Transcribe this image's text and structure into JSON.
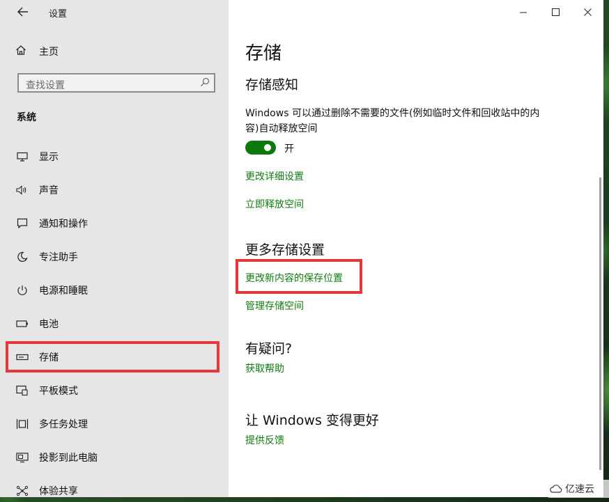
{
  "app": {
    "title": "设置"
  },
  "sidebar": {
    "home_label": "主页",
    "search_placeholder": "查找设置",
    "section_label": "系统",
    "items": [
      {
        "label": "显示",
        "icon": "monitor-icon"
      },
      {
        "label": "声音",
        "icon": "speaker-icon"
      },
      {
        "label": "通知和操作",
        "icon": "notification-icon"
      },
      {
        "label": "专注助手",
        "icon": "moon-icon"
      },
      {
        "label": "电源和睡眠",
        "icon": "power-icon"
      },
      {
        "label": "电池",
        "icon": "battery-icon"
      },
      {
        "label": "存储",
        "icon": "storage-icon",
        "selected": true
      },
      {
        "label": "平板模式",
        "icon": "tablet-icon"
      },
      {
        "label": "多任务处理",
        "icon": "multitask-icon"
      },
      {
        "label": "投影到此电脑",
        "icon": "project-icon"
      },
      {
        "label": "体验共享",
        "icon": "share-icon"
      }
    ]
  },
  "main": {
    "title": "存储",
    "storage_sense": {
      "heading": "存储感知",
      "description": "Windows 可以通过删除不需要的文件(例如临时文件和回收站中的内容)自动释放空间",
      "toggle_state": "开",
      "toggle_on": true,
      "links": [
        "更改详细设置",
        "立即释放空间"
      ]
    },
    "more_settings": {
      "heading": "更多存储设置",
      "links": [
        "更改新内容的保存位置",
        "管理存储空间"
      ]
    },
    "questions": {
      "heading": "有疑问?",
      "link": "获取帮助"
    },
    "feedback": {
      "heading": "让 Windows 变得更好",
      "link": "提供反馈"
    }
  },
  "watermark": {
    "text": "亿速云"
  },
  "colors": {
    "accent": "#107c10",
    "toggle": "#0e7a0d",
    "highlight": "#e5383b",
    "sidebar_bg": "#e6e6e6"
  }
}
